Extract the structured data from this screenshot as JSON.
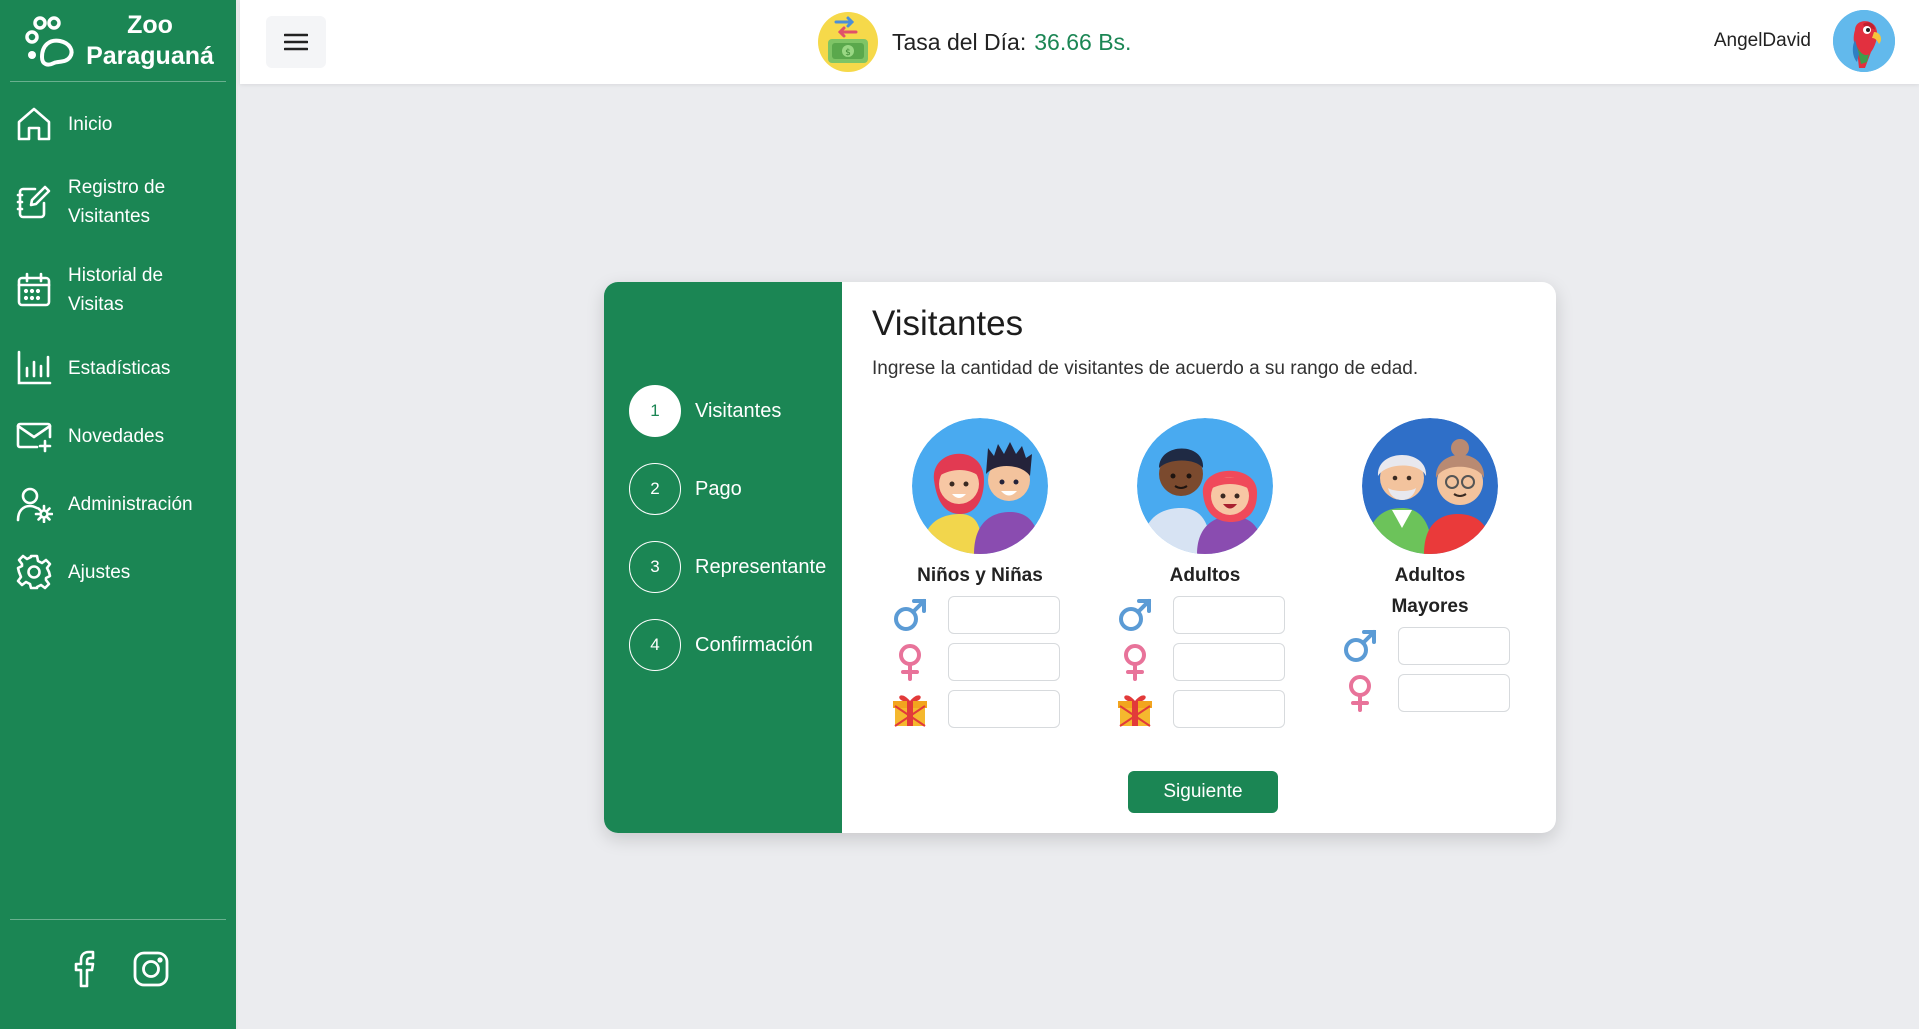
{
  "brand": {
    "line1": "Zoo",
    "line2": "Paraguaná"
  },
  "sidebar": {
    "items": [
      {
        "label": "Inicio",
        "icon": "home-icon"
      },
      {
        "label": "Registro de Visitantes",
        "line1": "Registro de",
        "line2": "Visitantes",
        "icon": "register-icon"
      },
      {
        "label": "Historial de Visitas",
        "line1": "Historial de",
        "line2": "Visitas",
        "icon": "calendar-icon"
      },
      {
        "label": "Estadísticas",
        "icon": "chart-icon"
      },
      {
        "label": "Novedades",
        "icon": "mail-icon"
      },
      {
        "label": "Administración",
        "icon": "user-gear-icon"
      },
      {
        "label": "Ajustes",
        "icon": "gear-icon"
      }
    ],
    "social": [
      "facebook-icon",
      "instagram-icon"
    ]
  },
  "topbar": {
    "rate_label": "Tasa del Día:",
    "rate_value": "36.66 Bs.",
    "username": "AngelDavid"
  },
  "steps": [
    {
      "number": "1",
      "label": "Visitantes",
      "active": true
    },
    {
      "number": "2",
      "label": "Pago",
      "active": false
    },
    {
      "number": "3",
      "label": "Representante",
      "active": false
    },
    {
      "number": "4",
      "label": "Confirmación",
      "active": false
    }
  ],
  "form": {
    "title": "Visitantes",
    "description": "Ingrese la cantidad de visitantes de acuerdo a su rango de edad.",
    "groups": [
      {
        "title": "Niños y Niñas",
        "fields": [
          "male",
          "female",
          "gift"
        ]
      },
      {
        "title": "Adultos",
        "fields": [
          "male",
          "female",
          "gift"
        ]
      },
      {
        "title_line1": "Adultos",
        "title_line2": "Mayores",
        "fields": [
          "male",
          "female"
        ]
      }
    ],
    "next_label": "Siguiente"
  },
  "colors": {
    "primary": "#1b8654",
    "male": "#5b9bd5",
    "female": "#e8739a",
    "background": "#ebecef"
  }
}
